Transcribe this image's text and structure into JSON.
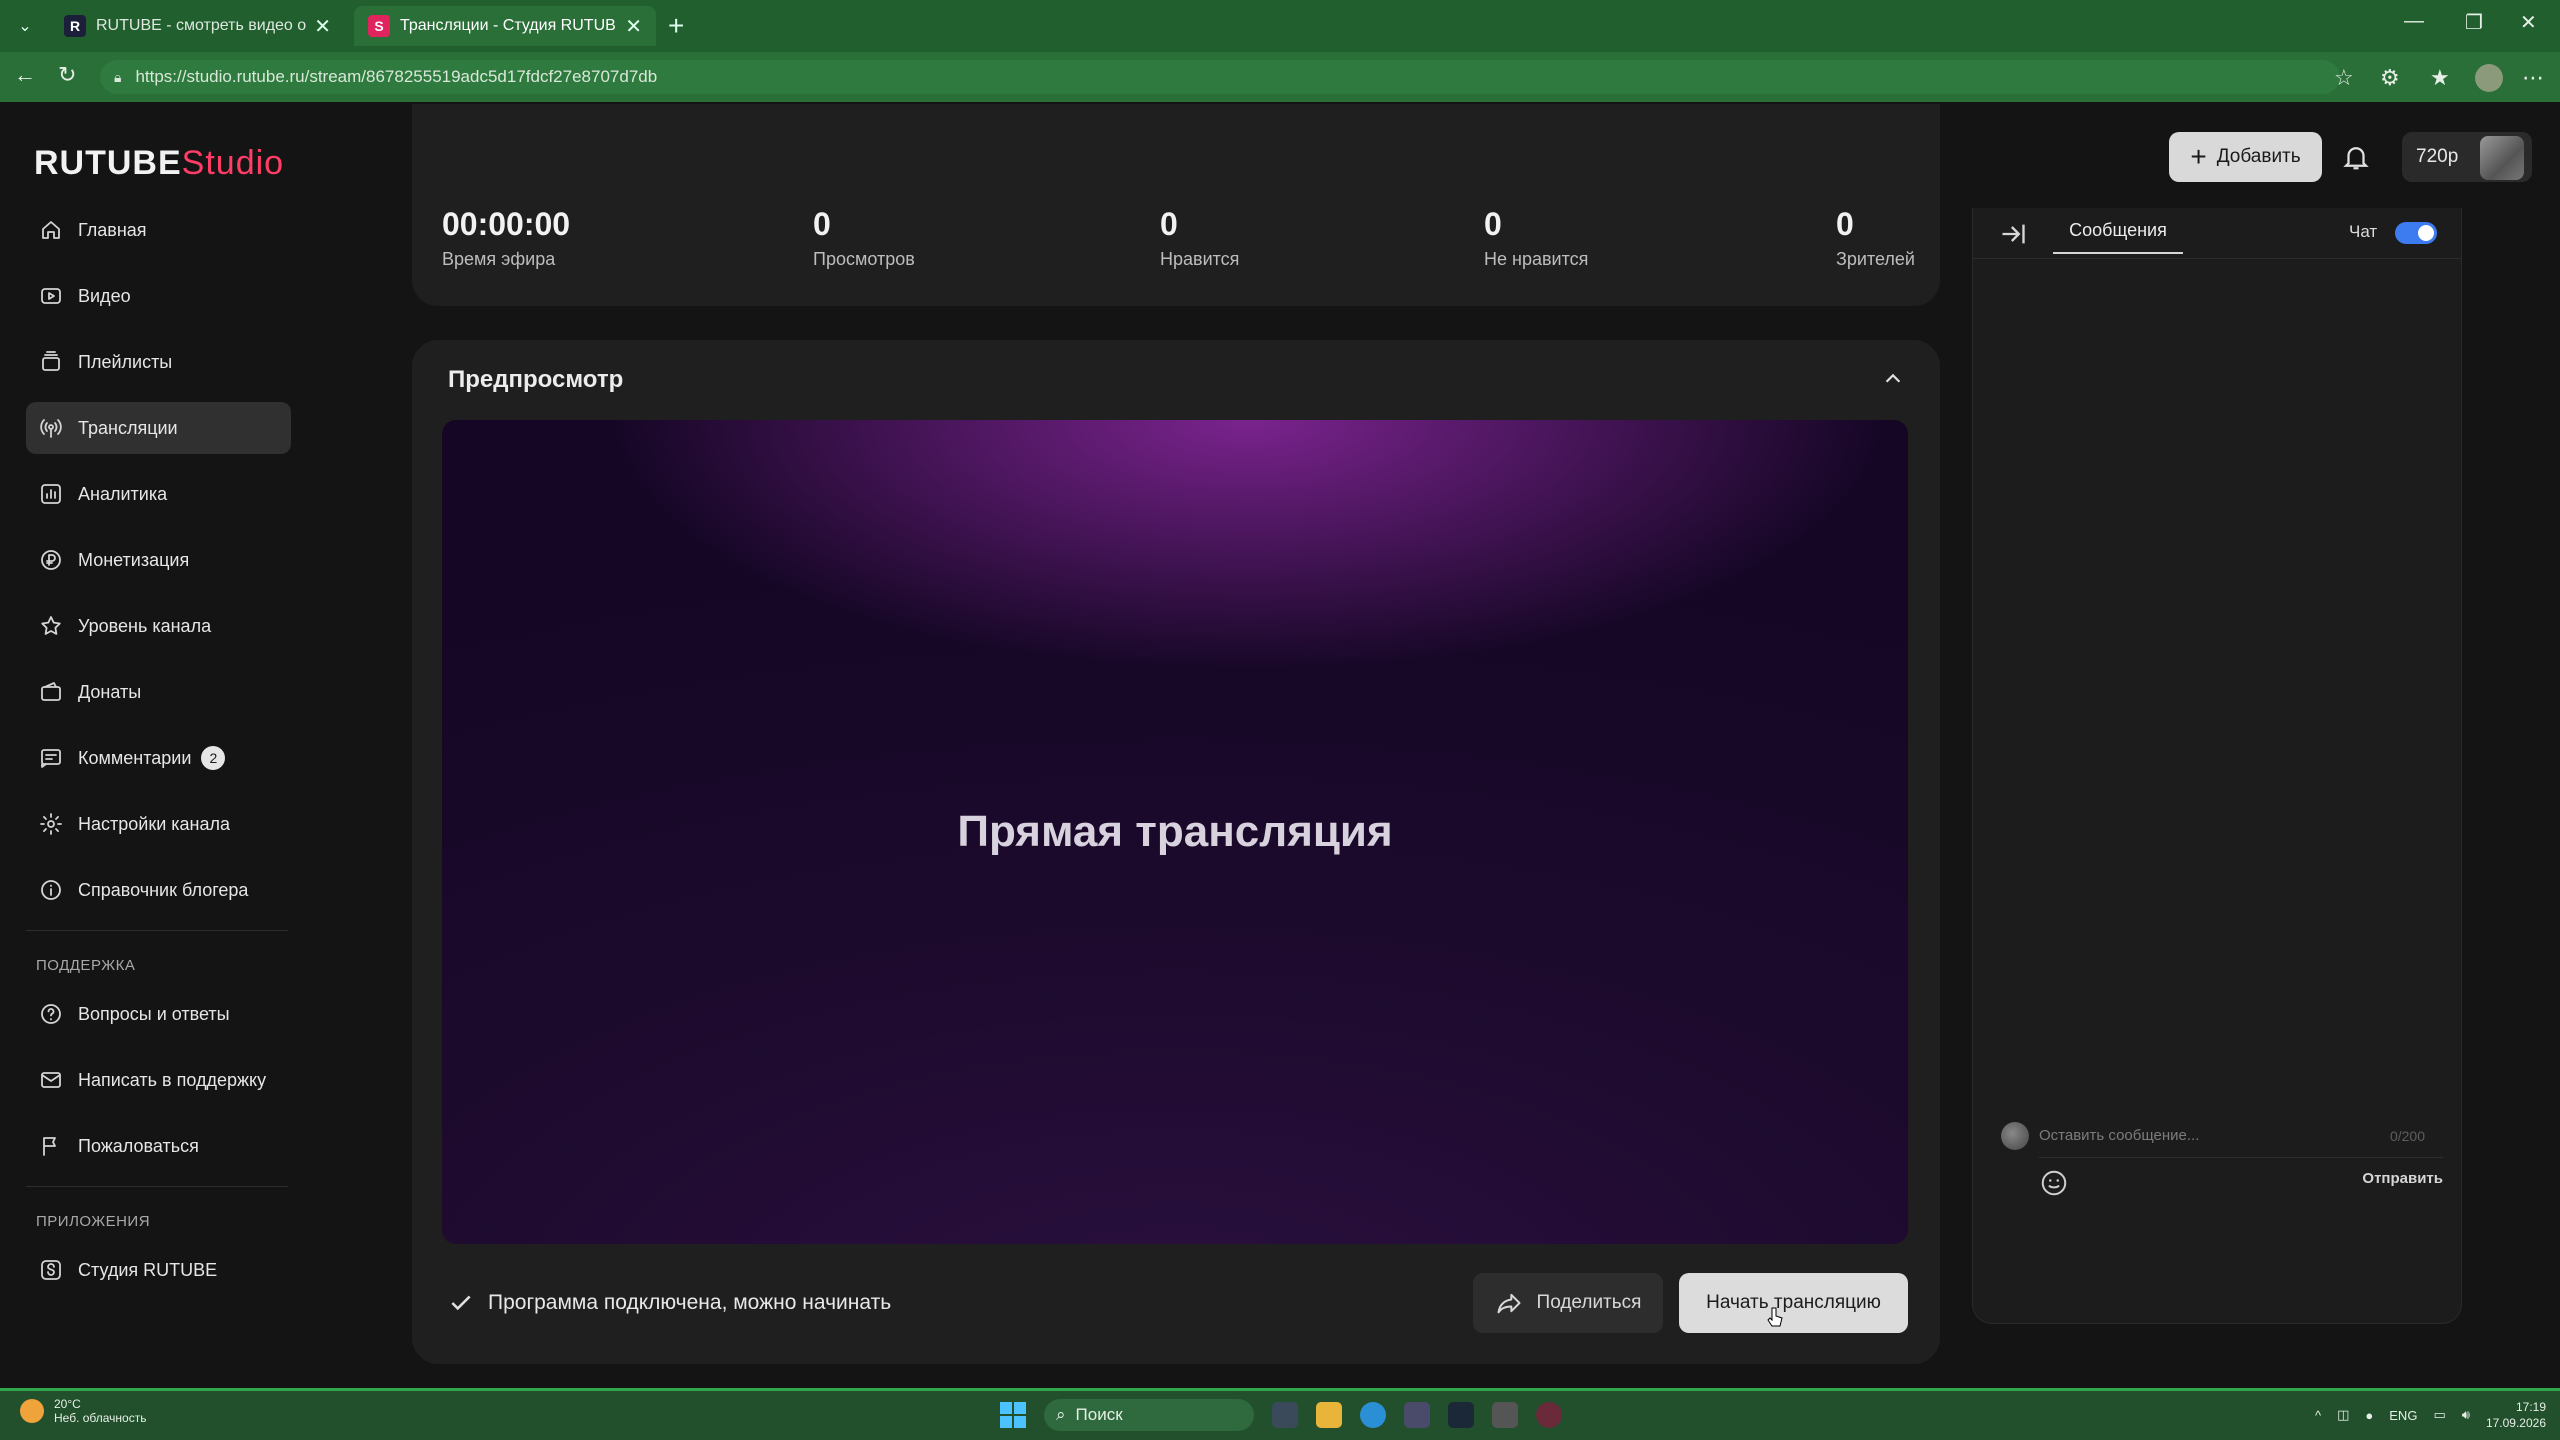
{
  "browser": {
    "tabs": [
      {
        "title": "RUTUBE - смотреть видео онлайн",
        "favicon": "R",
        "active": false
      },
      {
        "title": "Трансляции - Студия RUTUBE",
        "favicon": "S",
        "active": true
      }
    ],
    "url": "https://studio.rutube.ru/stream/8678255519adc5d17fdcf27e8707d7db"
  },
  "header": {
    "logo_main": "RUTUBE",
    "logo_sub": "Studio",
    "add_label": "Добавить",
    "quality_label": "720p"
  },
  "sidebar": {
    "items": [
      {
        "label": "Главная",
        "icon": "home-icon"
      },
      {
        "label": "Видео",
        "icon": "video-icon"
      },
      {
        "label": "Плейлисты",
        "icon": "playlist-icon"
      },
      {
        "label": "Трансляции",
        "icon": "broadcast-icon",
        "active": true
      },
      {
        "label": "Аналитика",
        "icon": "analytics-icon"
      },
      {
        "label": "Монетизация",
        "icon": "ruble-icon"
      },
      {
        "label": "Уровень канала",
        "icon": "star-icon"
      },
      {
        "label": "Донаты",
        "icon": "wallet-icon"
      },
      {
        "label": "Комментарии",
        "icon": "comment-icon",
        "badge": "2"
      },
      {
        "label": "Настройки канала",
        "icon": "gear-icon"
      },
      {
        "label": "Справочник блогера",
        "icon": "info-icon"
      }
    ],
    "support_heading": "ПОДДЕРЖКА",
    "support_items": [
      {
        "label": "Вопросы и ответы",
        "icon": "question-icon"
      },
      {
        "label": "Написать в поддержку",
        "icon": "mail-icon"
      },
      {
        "label": "Пожаловаться",
        "icon": "flag-icon"
      }
    ],
    "apps_heading": "ПРИЛОЖЕНИЯ",
    "apps_items": [
      {
        "label": "Студия RUTUBE",
        "icon": "studio-icon"
      }
    ]
  },
  "stats": [
    {
      "value": "00:00:00",
      "label": "Время эфира"
    },
    {
      "value": "0",
      "label": "Просмотров"
    },
    {
      "value": "0",
      "label": "Нравится"
    },
    {
      "value": "0",
      "label": "Не нравится"
    },
    {
      "value": "0",
      "label": "Зрителей"
    }
  ],
  "preview": {
    "title": "Предпросмотр",
    "video_text": "Прямая трансляция",
    "status": "Программа подключена, можно начинать",
    "share_label": "Поделиться",
    "start_label": "Начать трансляцию"
  },
  "chat": {
    "tab_label": "Сообщения",
    "toggle_label": "Чат",
    "toggle_on": true,
    "input_placeholder": "Оставить сообщение...",
    "counter": "0/200",
    "send_label": "Отправить"
  },
  "taskbar": {
    "temperature": "20°C",
    "weather": "Неб. облачность",
    "search_label": "Поиск",
    "lang": "ENG",
    "time": "17:19",
    "date": "17.09.2026"
  },
  "colors": {
    "brand_accent": "#ff3d66",
    "toggle_on": "#3c7cf0",
    "browser_frame": "#2a6e38"
  }
}
